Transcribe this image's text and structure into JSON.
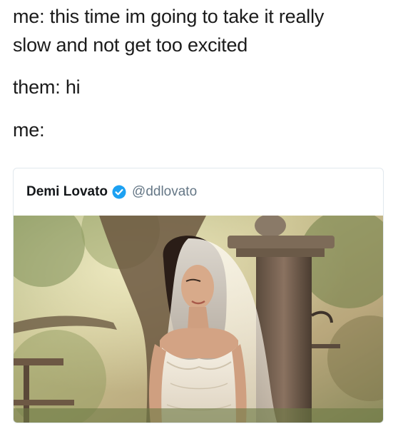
{
  "meme": {
    "line1": "me: this time im going to take it really",
    "line2": "slow and not get too excited",
    "line3": "them: hi",
    "line4": "me:"
  },
  "tweet": {
    "display_name": "Demi Lovato",
    "handle": "@ddlovato",
    "verified_icon": "verified-badge-icon",
    "verified_color": "#1da1f2"
  }
}
